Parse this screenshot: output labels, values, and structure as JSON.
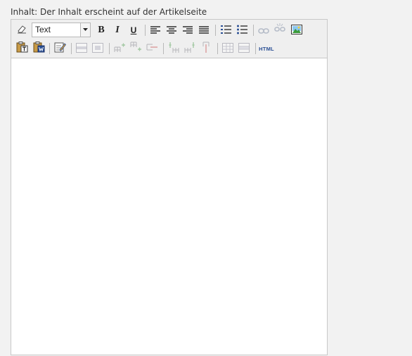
{
  "field": {
    "label": "Inhalt: Der Inhalt erscheint auf der Artikelseite"
  },
  "toolbar": {
    "row1": {
      "eraser_icon": "eraser-icon",
      "format_select_value": "Text",
      "bold_label": "B",
      "italic_label": "I",
      "underline_label": "U",
      "align_icons": [
        "align-left-icon",
        "align-center-icon",
        "align-right-icon",
        "align-justify-icon"
      ],
      "list_icons": [
        "ordered-list-icon",
        "unordered-list-icon"
      ],
      "link_icons": [
        "link-icon",
        "unlink-icon"
      ],
      "image_icon": "image-icon"
    },
    "row2": {
      "paste_icons": [
        "paste-text-icon",
        "paste-word-icon"
      ],
      "edit_icon": "edit-icon",
      "table_icons": [
        "table-row-props-icon",
        "table-cell-props-icon",
        "insert-row-before-icon",
        "insert-row-after-icon",
        "delete-row-icon",
        "insert-col-before-icon",
        "insert-col-after-icon",
        "delete-col-icon",
        "split-cells-icon",
        "merge-cells-icon"
      ],
      "html_label": "HTML"
    }
  },
  "colors": {
    "accent": "#2a4f94",
    "toolbar_bg": "#efefef",
    "border": "#c8c8c8"
  }
}
